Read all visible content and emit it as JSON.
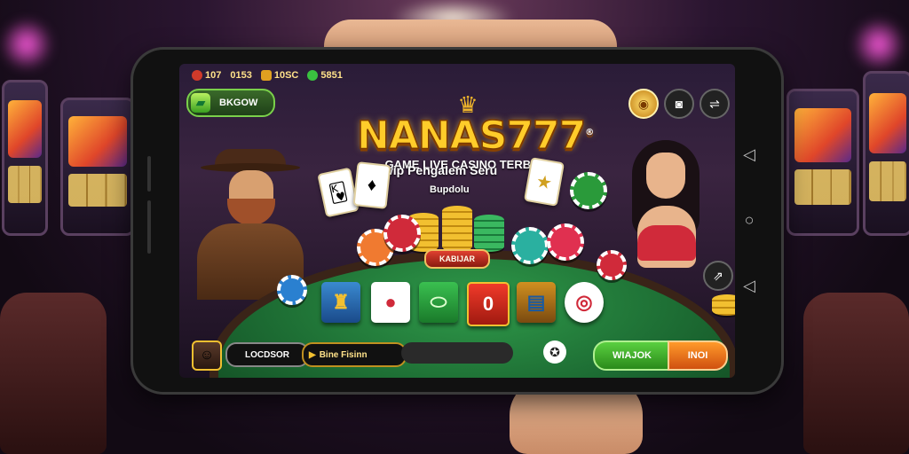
{
  "status_bar": {
    "items": [
      {
        "icon": "red-chip-icon",
        "text": "107"
      },
      {
        "icon": "",
        "text": "0153"
      },
      {
        "icon": "gold-box-icon",
        "text": "10SC"
      },
      {
        "icon": "green-gem-icon",
        "text": "5851"
      }
    ]
  },
  "menu": {
    "label": "BKGOW",
    "icon": "menu-card-icon"
  },
  "logo": {
    "crown": "♛",
    "name": "NANAS777",
    "registered": "®",
    "subtitle": "GAME LIVE CASINO TERBAIK"
  },
  "header_buttons": [
    {
      "name": "bonus-button",
      "icon": "coin-icon",
      "glyph": "◉"
    },
    {
      "name": "camera-button",
      "icon": "camera-icon",
      "glyph": "◙"
    },
    {
      "name": "settings-button",
      "icon": "toggle-icon",
      "glyph": "⇌"
    }
  ],
  "promo": {
    "line1": "Awip Pengalem Seru",
    "line2": "Bupdolu"
  },
  "table": {
    "center_label": "KABIJAR"
  },
  "tiles": [
    {
      "icon": "golden-bell-icon",
      "glyph": "♜"
    },
    {
      "icon": "poker-chip-icon",
      "glyph": "●"
    },
    {
      "icon": "green-oval-icon",
      "glyph": "⬭"
    },
    {
      "icon": "zero-tile-icon",
      "glyph": "0"
    },
    {
      "icon": "chip-stack-icon",
      "glyph": "▤"
    },
    {
      "icon": "red-chip-icon",
      "glyph": "◎"
    }
  ],
  "side_button": {
    "icon": "share-icon",
    "glyph": "⇗"
  },
  "bottom": {
    "field_left": "LOCDSOR",
    "field_mid": "Bine Fisinn",
    "shuffle_glyph": "✪",
    "left_action": "WIAJOK",
    "right_action": "INOI"
  },
  "colors": {
    "accent_gold": "#ffcc2a",
    "felt_green": "#2f9a4a",
    "action_green": "#3ab830",
    "action_orange": "#f07a1a"
  }
}
